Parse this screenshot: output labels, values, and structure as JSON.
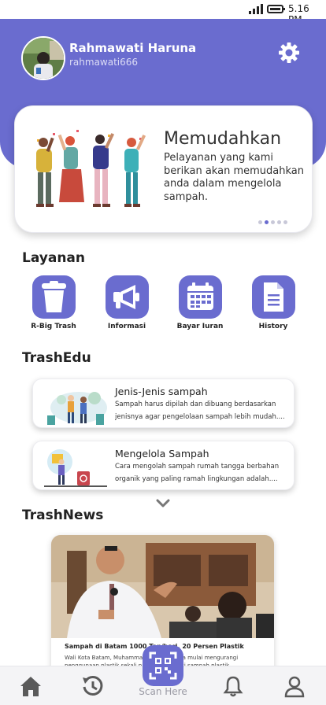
{
  "status_bar": {
    "time": "5.16 PM"
  },
  "profile": {
    "name": "Rahmawati Haruna",
    "username": "rahmawati666"
  },
  "hero": {
    "title": "Memudahkan",
    "description": "Pelayanan yang kami berikan akan memudahkan anda dalam mengelola sampah.",
    "slide_count": 5,
    "active_slide": 2
  },
  "sections": {
    "services": "Layanan",
    "edu": "TrashEdu",
    "news": "TrashNews"
  },
  "services": [
    {
      "label": "R-Big Trash",
      "icon": "trash-bin-icon"
    },
    {
      "label": "Informasi",
      "icon": "megaphone-icon"
    },
    {
      "label": "Bayar Iuran",
      "icon": "calendar-icon"
    },
    {
      "label": "History",
      "icon": "document-icon"
    }
  ],
  "edu": [
    {
      "title": "Jenis-Jenis sampah",
      "desc": "Sampah harus dipilah dan dibuang berdasarkan jenisnya agar pengelolaan sampah lebih mudah...."
    },
    {
      "title": "Mengelola Sampah",
      "desc": "Cara mengolah sampah rumah tangga berbahan organik yang paling ramah lingkungan adalah...."
    }
  ],
  "news": [
    {
      "title": "Sampah di Batam 1000 Ton/hari, 20 Persen Plastik",
      "desc": "Wali Kota Batam, Muhammad Rudi ... warga mulai mengurangi penggunaan plastik sekali pakai ... produksi sampah plastik"
    }
  ],
  "bottom_nav": {
    "scan_label": "Scan Here"
  },
  "colors": {
    "primary": "#6a6ccf",
    "background": "#ffffff"
  }
}
